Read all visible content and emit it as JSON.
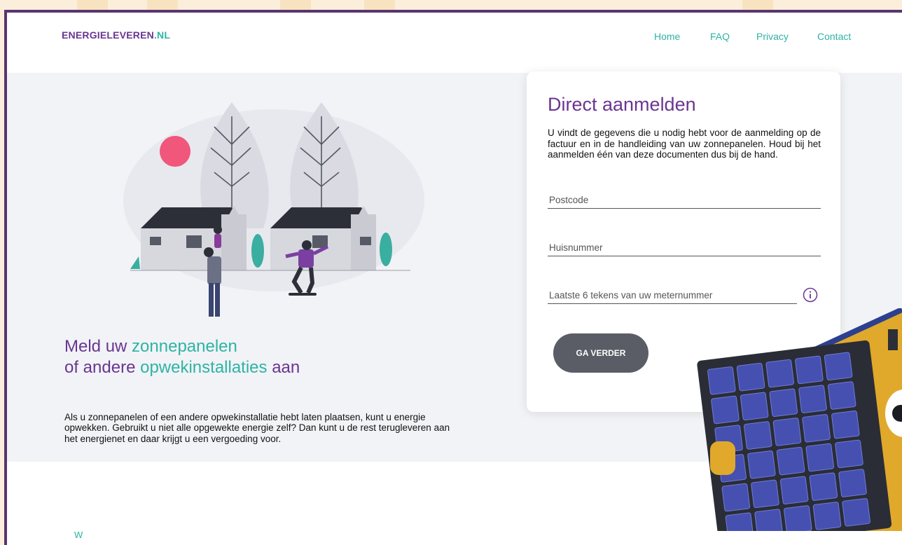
{
  "site": {
    "logo_main": "ENERGIELEVEREN",
    "logo_tld": ".NL"
  },
  "nav": {
    "items": [
      "Home",
      "FAQ",
      "Privacy",
      "Contact"
    ]
  },
  "hero": {
    "headline_1a": "Meld uw ",
    "headline_1b": "zonnepanelen",
    "headline_2a": "of andere ",
    "headline_2b": "opwekinstallaties",
    "headline_2c": " aan",
    "intro": "Als u zonnepanelen of een andere opwekinstallatie hebt laten plaatsen, kunt u energie opwekken. Gebruikt u niet alle opgewekte energie zelf? Dan kunt u de rest terugleveren aan het energienet en daar krijgt u een vergoeding voor."
  },
  "form": {
    "title": "Direct aanmelden",
    "description": "U vindt de gegevens die u nodig hebt voor de aanmelding op de factuur en in de handleiding van uw zonnepanelen. Houd bij het aanmelden één van deze documenten dus bij de hand.",
    "postcode_placeholder": "Postcode",
    "huisnummer_placeholder": "Huisnummer",
    "meter_placeholder": "Laatste 6 tekens van uw meternummer",
    "submit_label": "GA VERDER"
  },
  "section_next": {
    "title": "W"
  },
  "icons": {
    "info": "info-icon"
  },
  "colors": {
    "purple": "#6a3592",
    "teal": "#2fb3a5",
    "button": "#5a5d66",
    "frame": "#5a3470"
  }
}
